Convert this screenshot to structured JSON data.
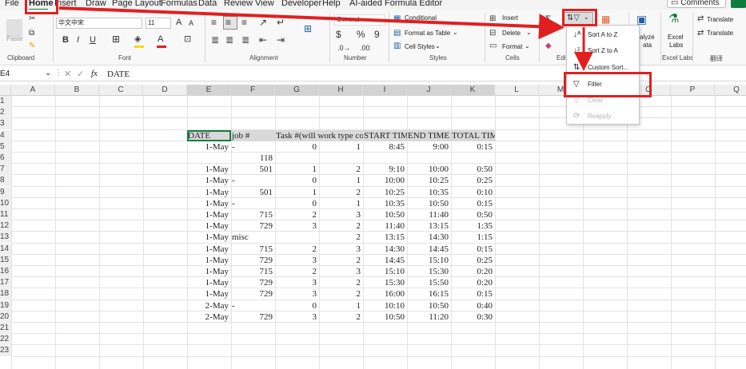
{
  "tabs": [
    "File",
    "Home",
    "Insert",
    "Draw",
    "Page Layout",
    "Formulas",
    "Data",
    "Review",
    "View",
    "Developer",
    "Help",
    "AI-aided Formula Editor"
  ],
  "comments_button": "Comments",
  "ribbon": {
    "clipboard": {
      "paste": "Paste",
      "label": "Clipboard"
    },
    "font": {
      "name": "华文中宋",
      "size": "11",
      "bold": "B",
      "italic": "I",
      "underline": "U",
      "grow": "A",
      "shrink": "A",
      "label": "Font"
    },
    "alignment": {
      "label": "Alignment"
    },
    "number": {
      "format": "General",
      "currency": "$",
      "percent": "%",
      "comma": "9",
      "label": "Number"
    },
    "styles": {
      "conditional": "Conditional",
      "format_table": "Format as Table",
      "cell_styles": "Cell Styles",
      "label": "Styles"
    },
    "cells": {
      "insert": "Insert",
      "delete": "Delete",
      "format": "Format",
      "label": "Cells"
    },
    "editing": {
      "label": "Edit"
    },
    "analyze": {
      "line1": "alyze",
      "line2": "ata"
    },
    "excel_labs": {
      "line1": "Excel",
      "line2": "Labs",
      "label": "Excel Labs"
    },
    "translate": {
      "translate1": "Translate",
      "translate2": "Translate",
      "label": "翻译"
    }
  },
  "sort_menu": {
    "items": [
      {
        "label": "Sort A to Z",
        "icon": "sort-az-icon",
        "enabled": true
      },
      {
        "label": "Sort Z to A",
        "icon": "sort-za-icon",
        "enabled": true
      },
      {
        "label": "Custom Sort...",
        "icon": "custom-sort-icon",
        "enabled": true
      },
      {
        "label": "Filter",
        "icon": "filter-icon",
        "enabled": true
      },
      {
        "label": "Clear",
        "icon": "clear-filter-icon",
        "enabled": false
      },
      {
        "label": "Reapply",
        "icon": "reapply-icon",
        "enabled": false
      }
    ]
  },
  "formula_bar": {
    "name_box": "E4",
    "fx": "fx",
    "content": "DATE"
  },
  "columns": [
    "A",
    "B",
    "C",
    "D",
    "E",
    "F",
    "G",
    "H",
    "I",
    "J",
    "K",
    "L",
    "M",
    "N",
    "O",
    "P",
    "Q"
  ],
  "rows": [
    "1",
    "2",
    "3",
    "4",
    "5",
    "6",
    "7",
    "8",
    "9",
    "10",
    "11",
    "12",
    "13",
    "14",
    "15",
    "16",
    "17",
    "18",
    "19",
    "20",
    "21",
    "22",
    "23"
  ],
  "sheet": {
    "headers": [
      "DATE",
      "job #",
      "Task #(will work type code)",
      "START TIME",
      "END TIME",
      "TOTAL TIME"
    ],
    "rows": [
      [
        "1-May",
        "-",
        "0",
        "1",
        "8:45",
        "9:00",
        "0:15"
      ],
      [
        "",
        "118",
        "",
        "",
        "",
        "",
        ""
      ],
      [
        "1-May",
        "501",
        "1",
        "2",
        "9:10",
        "10:00",
        "0:50"
      ],
      [
        "1-May",
        "-",
        "0",
        "1",
        "10:00",
        "10:25",
        "0:25"
      ],
      [
        "1-May",
        "501",
        "1",
        "2",
        "10:25",
        "10:35",
        "0:10"
      ],
      [
        "1-May",
        "-",
        "0",
        "1",
        "10:35",
        "10:50",
        "0:15"
      ],
      [
        "1-May",
        "715",
        "2",
        "3",
        "10:50",
        "11:40",
        "0:50"
      ],
      [
        "1-May",
        "729",
        "3",
        "2",
        "11:40",
        "13:15",
        "1:35"
      ],
      [
        "1-May",
        "misc",
        "",
        "2",
        "13:15",
        "14:30",
        "1:15"
      ],
      [
        "1-May",
        "715",
        "2",
        "3",
        "14:30",
        "14:45",
        "0:15"
      ],
      [
        "1-May",
        "729",
        "3",
        "2",
        "14:45",
        "15:10",
        "0:25"
      ],
      [
        "1-May",
        "715",
        "2",
        "3",
        "15:10",
        "15:30",
        "0:20"
      ],
      [
        "1-May",
        "729",
        "3",
        "2",
        "15:30",
        "15:50",
        "0:20"
      ],
      [
        "1-May",
        "729",
        "3",
        "2",
        "16:00",
        "16:15",
        "0:15"
      ],
      [
        "2-May",
        "-",
        "0",
        "1",
        "10:10",
        "10:50",
        "0:40"
      ],
      [
        "2-May",
        "729",
        "3",
        "2",
        "10:50",
        "11:20",
        "0:30"
      ]
    ]
  },
  "colors": {
    "accent": "#107c41",
    "highlight": "#e02020",
    "header_fill": "#d9d9d9"
  }
}
